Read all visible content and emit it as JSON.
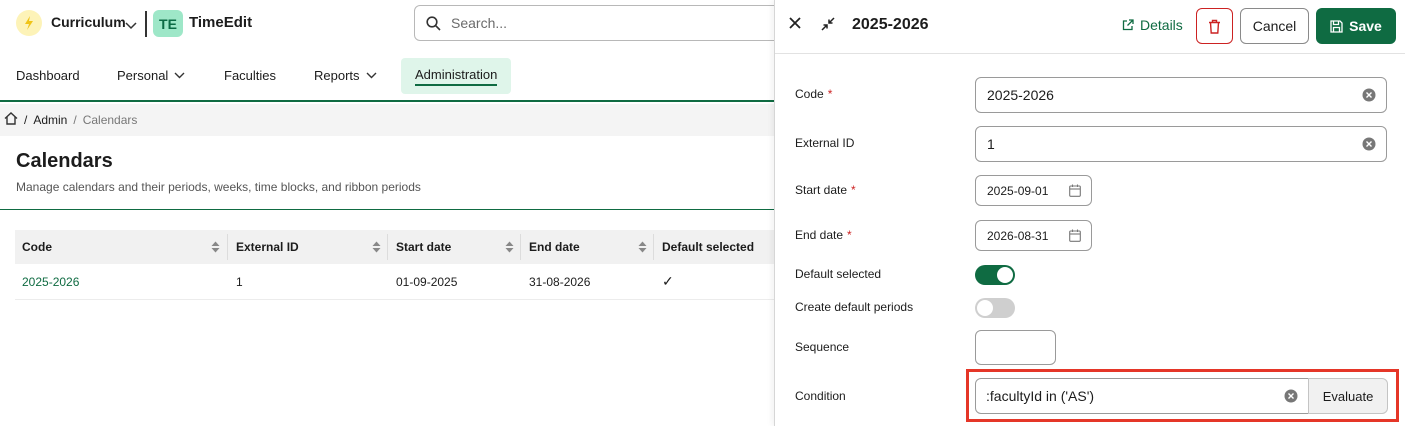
{
  "header": {
    "app_switcher": "Curriculum",
    "brand_mark": "TE",
    "brand": "TimeEdit",
    "search_placeholder": "Search..."
  },
  "nav": {
    "items": [
      {
        "label": "Dashboard"
      },
      {
        "label": "Personal"
      },
      {
        "label": "Faculties"
      },
      {
        "label": "Reports"
      },
      {
        "label": "Administration"
      }
    ],
    "active": "Administration"
  },
  "breadcrumb": {
    "separator": "/",
    "admin": "Admin",
    "current": "Calendars"
  },
  "page": {
    "title": "Calendars",
    "subtitle": "Manage calendars and their periods, weeks, time blocks, and ribbon periods"
  },
  "table": {
    "columns": [
      "Code",
      "External ID",
      "Start date",
      "End date",
      "Default selected"
    ],
    "rows": [
      {
        "code": "2025-2026",
        "external_id": "1",
        "start_date": "01-09-2025",
        "end_date": "31-08-2026",
        "default_selected": "✓"
      }
    ]
  },
  "panel": {
    "title": "2025-2026",
    "details_label": "Details",
    "cancel_label": "Cancel",
    "save_label": "Save",
    "fields": {
      "code": {
        "label": "Code",
        "value": "2025-2026",
        "required": "*"
      },
      "external_id": {
        "label": "External ID",
        "value": "1"
      },
      "start_date": {
        "label": "Start date",
        "value": "2025-09-01",
        "required": "*"
      },
      "end_date": {
        "label": "End date",
        "value": "2026-08-31",
        "required": "*"
      },
      "default_selected": {
        "label": "Default selected",
        "on": true
      },
      "create_default_periods": {
        "label": "Create default periods",
        "on": false
      },
      "sequence": {
        "label": "Sequence",
        "value": ""
      },
      "condition": {
        "label": "Condition",
        "value": ":facultyId in ('AS')"
      }
    },
    "evaluate_label": "Evaluate"
  },
  "colors": {
    "brand_green": "#0f6b42",
    "active_tab_bg": "#dff5ea",
    "danger": "#cc2222",
    "highlight": "#e53628"
  }
}
